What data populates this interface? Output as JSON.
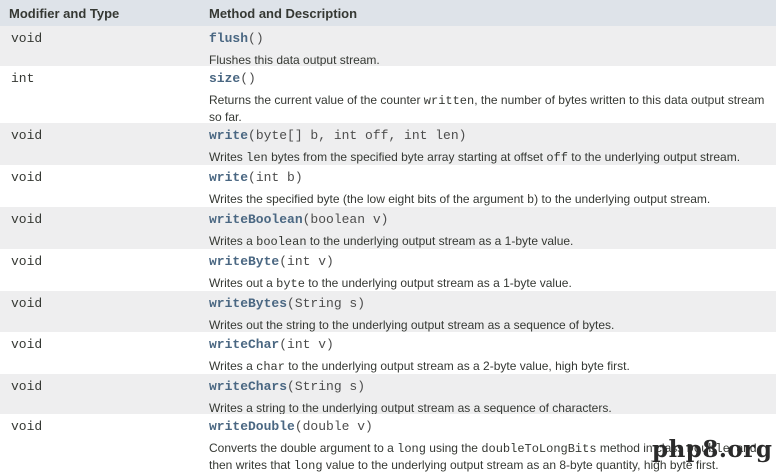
{
  "header": {
    "modifier_col": "Modifier and Type",
    "method_col": "Method and Description"
  },
  "rows": [
    {
      "type": "void",
      "name": "flush",
      "params": "()",
      "desc": [
        "Flushes this data output stream."
      ]
    },
    {
      "type": "int",
      "name": "size",
      "params": "()",
      "desc": [
        "Returns the current value of the counter ",
        "written",
        ", the number of bytes written to this data output stream so far."
      ]
    },
    {
      "type": "void",
      "name": "write",
      "params": "(byte[] b, int off, int len)",
      "desc": [
        "Writes ",
        "len",
        " bytes from the specified byte array starting at offset ",
        "off",
        " to the underlying output stream."
      ]
    },
    {
      "type": "void",
      "name": "write",
      "params": "(int b)",
      "desc": [
        "Writes the specified byte (the low eight bits of the argument ",
        "b",
        ") to the underlying output stream."
      ]
    },
    {
      "type": "void",
      "name": "writeBoolean",
      "params": "(boolean v)",
      "desc": [
        "Writes a ",
        "boolean",
        " to the underlying output stream as a 1-byte value."
      ]
    },
    {
      "type": "void",
      "name": "writeByte",
      "params": "(int v)",
      "desc": [
        "Writes out a ",
        "byte",
        " to the underlying output stream as a 1-byte value."
      ]
    },
    {
      "type": "void",
      "name": "writeBytes",
      "params": "(String s)",
      "desc": [
        "Writes out the string to the underlying output stream as a sequence of bytes."
      ]
    },
    {
      "type": "void",
      "name": "writeChar",
      "params": "(int v)",
      "desc": [
        "Writes a ",
        "char",
        " to the underlying output stream as a 2-byte value, high byte first."
      ]
    },
    {
      "type": "void",
      "name": "writeChars",
      "params": "(String s)",
      "desc": [
        "Writes a string to the underlying output stream as a sequence of characters."
      ]
    },
    {
      "type": "void",
      "name": "writeDouble",
      "params": "(double v)",
      "desc": [
        "Converts the double argument to a ",
        "long",
        " using the ",
        "doubleToLongBits",
        " method in class ",
        "Double",
        ", and then writes that ",
        "long",
        " value to the underlying output stream as an 8-byte quantity, high byte first."
      ]
    }
  ],
  "watermark": "php8.org"
}
